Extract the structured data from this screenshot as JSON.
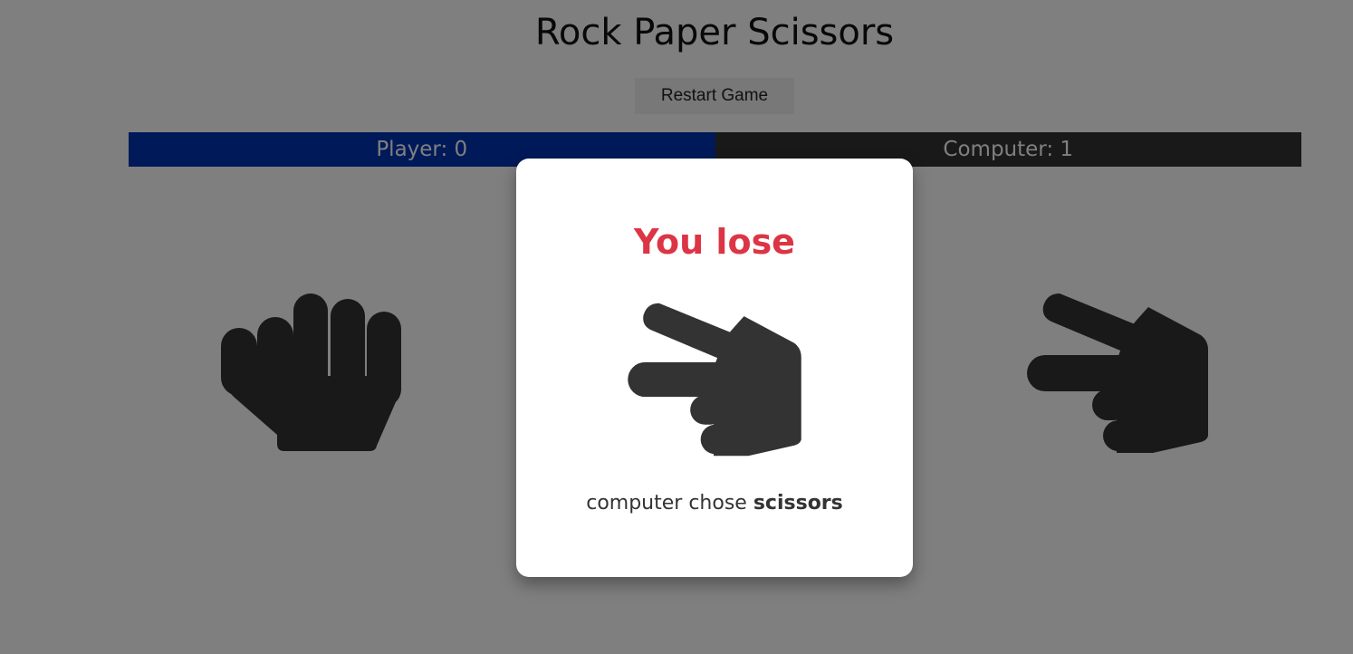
{
  "app": {
    "title": "Rock Paper Scissors",
    "restart_label": "Restart Game"
  },
  "score": {
    "player_label": "Player: 0",
    "computer_label": "Computer: 1"
  },
  "choices": [
    {
      "name": "rock",
      "icon": "fist-icon"
    },
    {
      "name": "scissors",
      "icon": "scissors-hand-icon"
    }
  ],
  "modal": {
    "result_text": "You lose",
    "prefix_text": "computer chose",
    "computer_choice": "scissors",
    "icon": "scissors-hand-icon"
  },
  "colors": {
    "player_bar": "#0033b3",
    "computer_bar": "#333333",
    "lose_text": "#dc3545",
    "overlay": "rgba(0,0,0,0.5)"
  }
}
